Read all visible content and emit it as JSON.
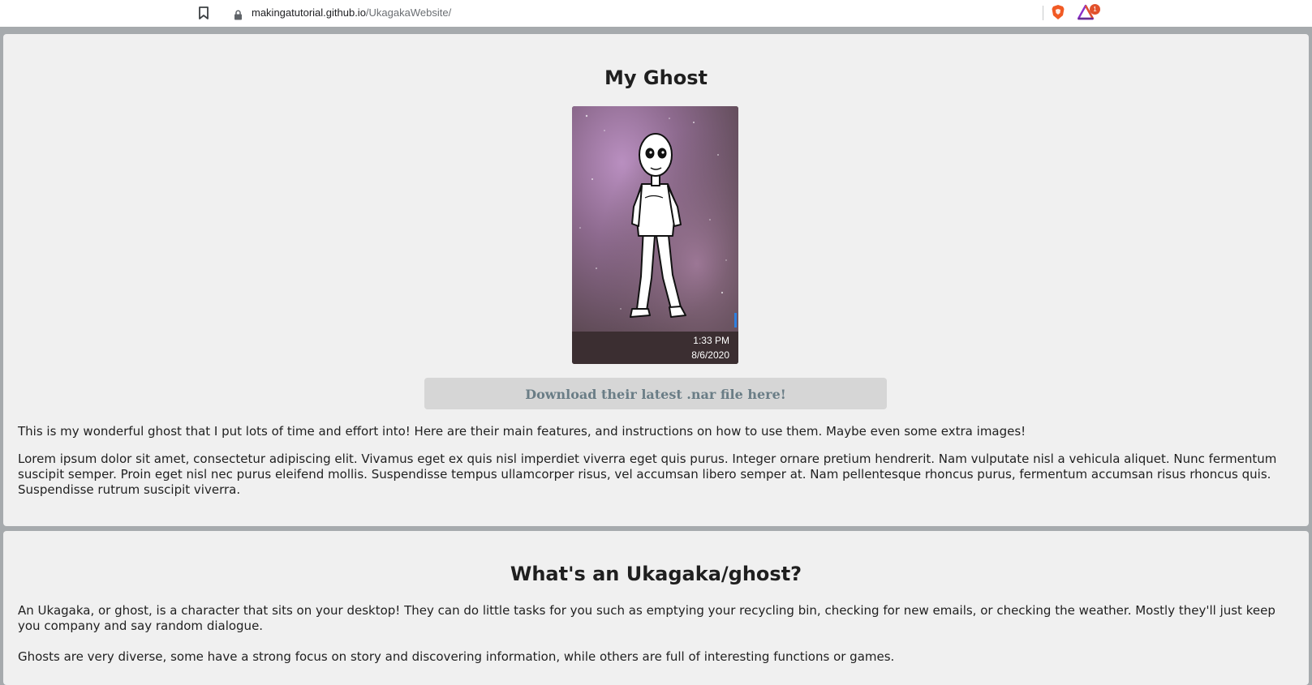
{
  "browser": {
    "url_host": "makingatutorial.github.io",
    "url_path": "/UkagakaWebsite/",
    "rewards_badge_count": "1",
    "icons": [
      "bookmark-icon",
      "lock-icon",
      "brave-shield-icon",
      "brave-rewards-icon"
    ]
  },
  "ghost_section": {
    "title": "My Ghost",
    "image_timestamp_time": "1:33 PM",
    "image_timestamp_date": "8/6/2020",
    "download_label": "Download their latest .nar file here!",
    "intro": "This is my wonderful ghost that I put lots of time and effort into! Here are their main features, and instructions on how to use them. Maybe even some extra images!",
    "lorem": "Lorem ipsum dolor sit amet, consectetur adipiscing elit. Vivamus eget ex quis nisl imperdiet viverra eget quis purus. Integer ornare pretium hendrerit. Nam vulputate nisl a vehicula aliquet. Nunc fermentum suscipit semper. Proin eget nisl nec purus eleifend mollis. Suspendisse tempus ullamcorper risus, vel accumsan libero semper at. Nam pellentesque rhoncus purus, fermentum accumsan risus rhoncus quis. Suspendisse rutrum suscipit viverra."
  },
  "about_section": {
    "title": "What's an Ukagaka/ghost?",
    "paragraph_1": "An Ukagaka, or ghost, is a character that sits on your desktop! They can do little tasks for you such as emptying your recycling bin, checking for new emails, or checking the weather. Mostly they'll just keep you company and say random dialogue.",
    "paragraph_2": "Ghosts are very diverse, some have a strong focus on story and discovering information, while others are full of interesting functions or games."
  },
  "colors": {
    "page_background": "#a6aaad",
    "panel_background": "#f0f0f0",
    "button_background": "#d6d6d6",
    "button_text": "#6a7d86",
    "card_footer": "#3b2e31"
  }
}
